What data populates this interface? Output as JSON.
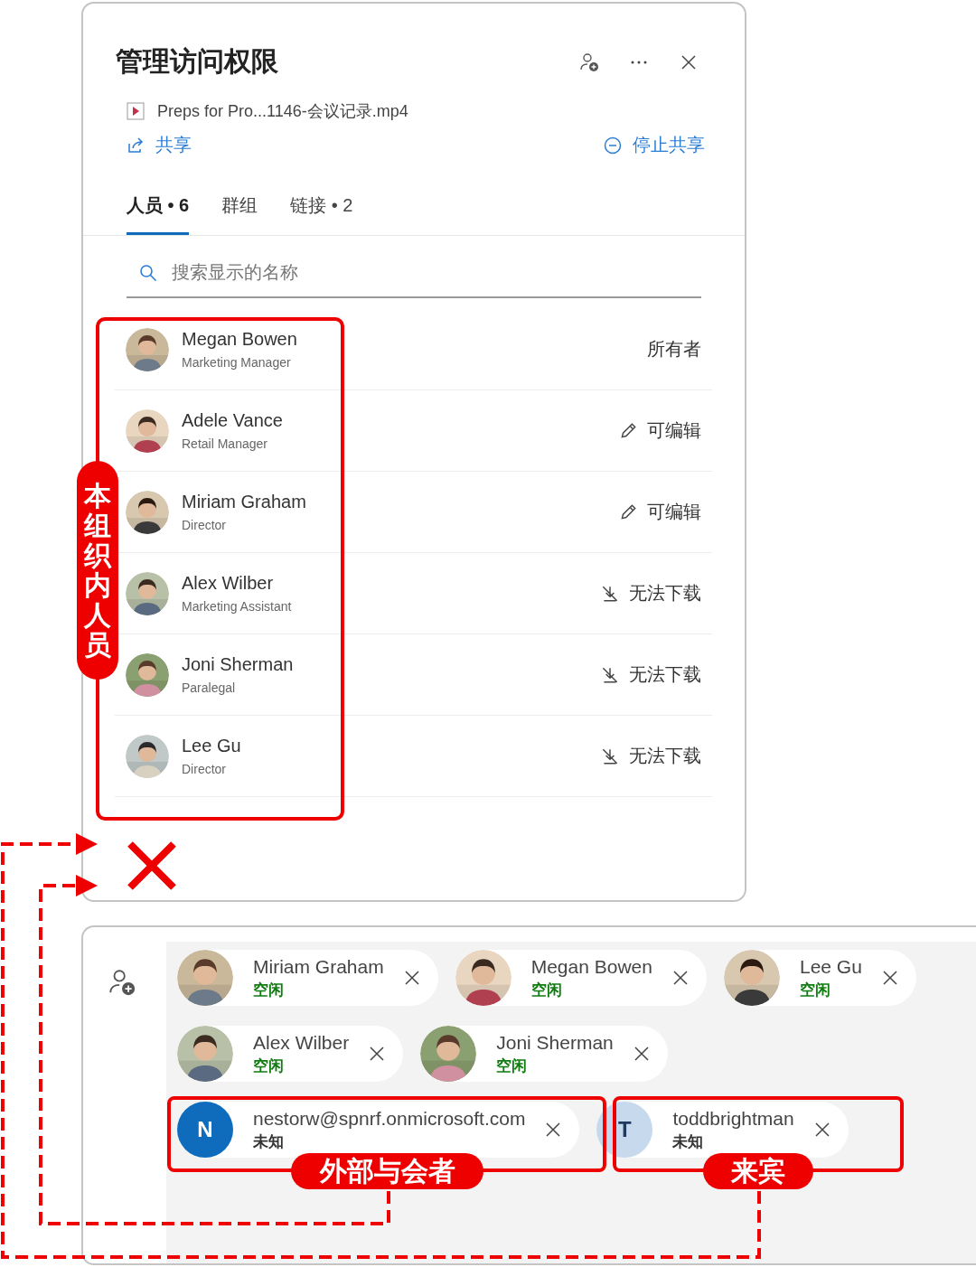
{
  "panel": {
    "title": "管理访问权限",
    "file_name": "Preps for Pro...1146-会议记录.mp4",
    "share_link": "共享",
    "stop_sharing_link": "停止共享",
    "tabs": [
      {
        "label": "人员 • 6",
        "selected": true
      },
      {
        "label": "群组",
        "selected": false
      },
      {
        "label": "链接 • 2",
        "selected": false
      }
    ],
    "search": {
      "placeholder": "搜索显示的名称"
    },
    "people": [
      {
        "name": "Megan Bowen",
        "role": "Marketing Manager",
        "kind": "owner",
        "permission": "所有者"
      },
      {
        "name": "Adele Vance",
        "role": "Retail Manager",
        "kind": "edit",
        "permission": "可编辑"
      },
      {
        "name": "Miriam Graham",
        "role": "Director",
        "kind": "edit",
        "permission": "可编辑"
      },
      {
        "name": "Alex Wilber",
        "role": "Marketing Assistant",
        "kind": "no_download",
        "permission": "无法下载"
      },
      {
        "name": "Joni Sherman",
        "role": "Paralegal",
        "kind": "no_download",
        "permission": "无法下载"
      },
      {
        "name": "Lee Gu",
        "role": "Director",
        "kind": "no_download",
        "permission": "无法下载"
      }
    ]
  },
  "attendees": {
    "rows": [
      {
        "chips": [
          {
            "name": "Miriam Graham",
            "status": "空闲"
          },
          {
            "name": "Megan Bowen",
            "status": "空闲"
          },
          {
            "name": "Lee Gu",
            "status": "空闲"
          }
        ]
      },
      {
        "chips": [
          {
            "name": "Alex Wilber",
            "status": "空闲"
          },
          {
            "name": "Joni Sherman",
            "status": "空闲"
          }
        ]
      },
      {
        "chips": [
          {
            "kind": "initial",
            "initial": "N",
            "color": "#0f6cbd",
            "name": "nestorw@spnrf.onmicrosoft.com",
            "status": "未知"
          },
          {
            "kind": "initial",
            "initial": "T",
            "color": "#c7d9ec",
            "name": "toddbrightman",
            "status": "未知"
          }
        ]
      }
    ]
  },
  "annotations": {
    "internal_label": "本组织内人员",
    "external_label": "外部与会者",
    "guest_label": "来宾"
  }
}
